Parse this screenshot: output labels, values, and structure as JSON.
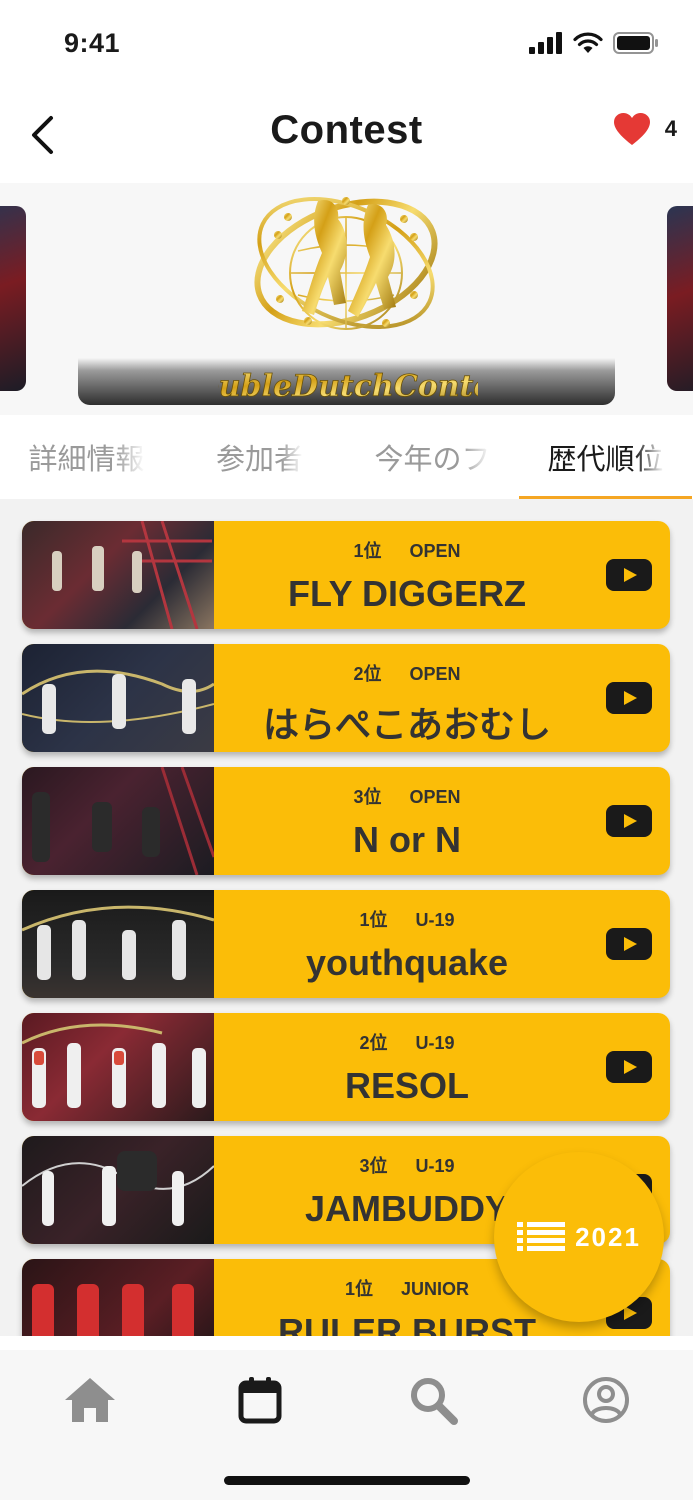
{
  "status_bar": {
    "time": "9:41"
  },
  "header": {
    "title": "Contest",
    "favorite_count": "4"
  },
  "carousel": {
    "logo_text": "DoubleDutchContest"
  },
  "tabs": [
    {
      "label": "詳細情報",
      "active": false
    },
    {
      "label": "参加者",
      "active": false
    },
    {
      "label": "今年のフ",
      "active": false
    },
    {
      "label": "歴代順位",
      "active": true
    }
  ],
  "rankings": [
    {
      "rank": "1位",
      "division": "OPEN",
      "team": "FLY DIGGERZ"
    },
    {
      "rank": "2位",
      "division": "OPEN",
      "team": "はらぺこあおむし"
    },
    {
      "rank": "3位",
      "division": "OPEN",
      "team": "N or N"
    },
    {
      "rank": "1位",
      "division": "U-19",
      "team": "youthquake"
    },
    {
      "rank": "2位",
      "division": "U-19",
      "team": "RESOL"
    },
    {
      "rank": "3位",
      "division": "U-19",
      "team": "JAMBUDDY"
    },
    {
      "rank": "1位",
      "division": "JUNIOR",
      "team": "RULER BURST"
    }
  ],
  "fab": {
    "year": "2021"
  },
  "bottom_nav": [
    {
      "icon": "home-icon",
      "active": false
    },
    {
      "icon": "calendar-icon",
      "active": true
    },
    {
      "icon": "search-icon",
      "active": false
    },
    {
      "icon": "profile-icon",
      "active": false
    }
  ],
  "colors": {
    "accent": "#fbbd08",
    "tab_indicator": "#f5a623",
    "heart": "#e53935",
    "text_dark": "#333333",
    "inactive": "#8e8e8e"
  }
}
